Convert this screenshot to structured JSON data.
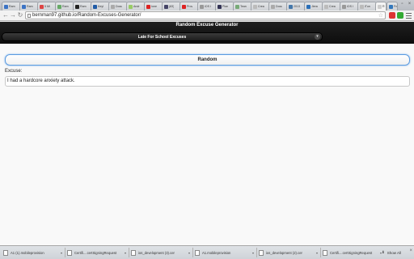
{
  "browser": {
    "tabs": [
      {
        "label": "Ram"
      },
      {
        "label": "Ram"
      },
      {
        "label": "5 Mi"
      },
      {
        "label": "Ram"
      },
      {
        "label": "Ram"
      },
      {
        "label": "Keyl"
      },
      {
        "label": "Docu"
      },
      {
        "label": "Andr"
      },
      {
        "label": "Ione"
      },
      {
        "label": "(83)"
      },
      {
        "label": "Prov"
      },
      {
        "label": "iOS I"
      },
      {
        "label": "Plan"
      },
      {
        "label": "Tean"
      },
      {
        "label": "Crea"
      },
      {
        "label": "Docu"
      },
      {
        "label": "2013"
      },
      {
        "label": "Jiera"
      },
      {
        "label": "Crea"
      },
      {
        "label": "iOS I"
      },
      {
        "label": "iTun"
      },
      {
        "label": "R"
      },
      {
        "label": "Free"
      }
    ],
    "url": "bernman97.github.io/Random-Excuses-Generator/",
    "colors": {
      "accent": "#5b9be0"
    }
  },
  "page": {
    "title": "Random Excuse Generator",
    "category_select": "Late For School Excuses",
    "random_button": "Random",
    "excuse_label": "Excuse:",
    "excuse_text": "I had a hardcore anxiety attack."
  },
  "downloads": {
    "items": [
      {
        "name": "A1 (1).mobileprovision"
      },
      {
        "name": "Certifi....certSigningRequest"
      },
      {
        "name": "ios_development (3).cer"
      },
      {
        "name": "A1.mobileprovision"
      },
      {
        "name": "ios_development (2).cer"
      },
      {
        "name": "Certifi....certSigningRequest"
      }
    ],
    "show_all": "Show All"
  }
}
